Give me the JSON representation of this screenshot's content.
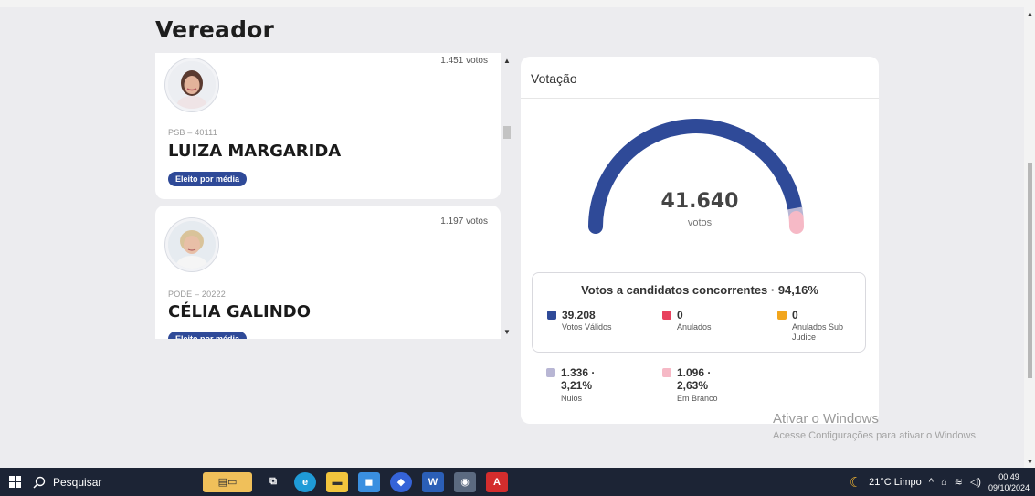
{
  "page": {
    "title": "Vereador"
  },
  "candidates": [
    {
      "votes": "1.451 votos",
      "party": "PSB – 40111",
      "name": "LUIZA MARGARIDA",
      "status": "Eleito por média"
    },
    {
      "votes": "1.197 votos",
      "party": "PODE – 20222",
      "name": "CÉLIA GALINDO",
      "status": "Eleito por média"
    }
  ],
  "votacao": {
    "title": "Votação",
    "total": "41.640",
    "total_label": "votos",
    "summary_title": "Votos a candidatos concorrentes · 94,16%",
    "stats": [
      {
        "value": "39.208",
        "label": "Votos Válidos",
        "color": "#2f4a98"
      },
      {
        "value": "0",
        "label": "Anulados",
        "color": "#e8425e"
      },
      {
        "value": "0",
        "label": "Anulados Sub Judice",
        "color": "#f2a61d"
      }
    ],
    "extra": [
      {
        "value_line1": "1.336 ·",
        "value_line2": "3,21%",
        "label": "Nulos",
        "color": "#b8b6d4"
      },
      {
        "value_line1": "1.096 ·",
        "value_line2": "2,63%",
        "label": "Em Branco",
        "color": "#f6b9c6"
      }
    ],
    "gauge_fractions": {
      "valid": 0.9416,
      "nulos": 0.0321,
      "branco": 0.0263
    }
  },
  "watermark": {
    "line1": "Ativar o Windows",
    "line2": "Acesse Configurações para ativar o Windows."
  },
  "taskbar": {
    "search_label": "Pesquisar",
    "weather": "21°C  Limpo",
    "time": "00:49",
    "date": "09/10/2024"
  }
}
